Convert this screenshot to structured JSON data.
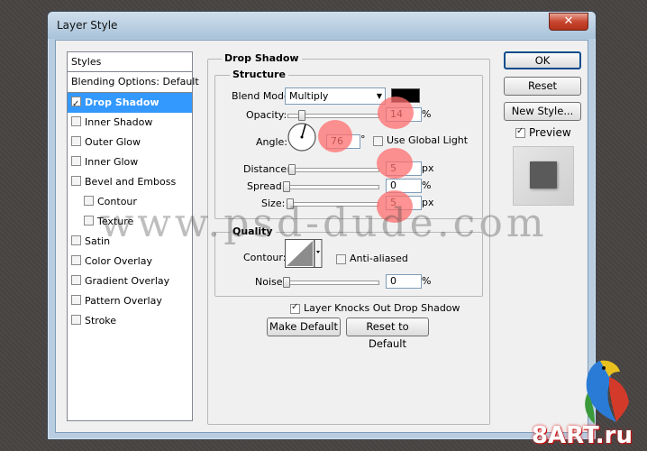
{
  "window": {
    "title": "Layer Style",
    "close_glyph": "✕"
  },
  "styles_list": {
    "header": "Styles",
    "blending": "Blending Options: Default",
    "items": [
      {
        "label": "Drop Shadow",
        "checked": true
      },
      {
        "label": "Inner Shadow",
        "checked": false
      },
      {
        "label": "Outer Glow",
        "checked": false
      },
      {
        "label": "Inner Glow",
        "checked": false
      },
      {
        "label": "Bevel and Emboss",
        "checked": false
      },
      {
        "label": "Contour",
        "checked": false
      },
      {
        "label": "Texture",
        "checked": false
      },
      {
        "label": "Satin",
        "checked": false
      },
      {
        "label": "Color Overlay",
        "checked": false
      },
      {
        "label": "Gradient Overlay",
        "checked": false
      },
      {
        "label": "Pattern Overlay",
        "checked": false
      },
      {
        "label": "Stroke",
        "checked": false
      }
    ]
  },
  "drop_shadow": {
    "group_title": "Drop Shadow",
    "structure_title": "Structure",
    "blend_mode_label": "Blend Mode:",
    "blend_mode_value": "Multiply",
    "shadow_color": "#000000",
    "opacity_label": "Opacity:",
    "opacity_value": "14",
    "percent": "%",
    "angle_label": "Angle:",
    "angle_value": "76",
    "degree": "°",
    "global_light_label": "Use Global Light",
    "global_light_checked": false,
    "distance_label": "Distance:",
    "distance_value": "5",
    "px": "px",
    "spread_label": "Spread:",
    "spread_value": "0",
    "size_label": "Size:",
    "size_value": "5",
    "quality_title": "Quality",
    "contour_label": "Contour:",
    "anti_aliased_label": "Anti-aliased",
    "noise_label": "Noise:",
    "noise_value": "0",
    "knockout_label": "Layer Knocks Out Drop Shadow",
    "knockout_checked": true,
    "make_default": "Make Default",
    "reset_default": "Reset to Default"
  },
  "buttons": {
    "ok": "OK",
    "reset": "Reset",
    "new_style": "New Style...",
    "preview_label": "Preview",
    "preview_checked": true
  },
  "watermark": "www.psd-dude.com",
  "brand": "8ART.ru",
  "colors": {
    "selection": "#3399ff",
    "title_gradient_top": "#cfdeec",
    "close_button": "#c8462f",
    "highlight": "#ff6e6e"
  }
}
